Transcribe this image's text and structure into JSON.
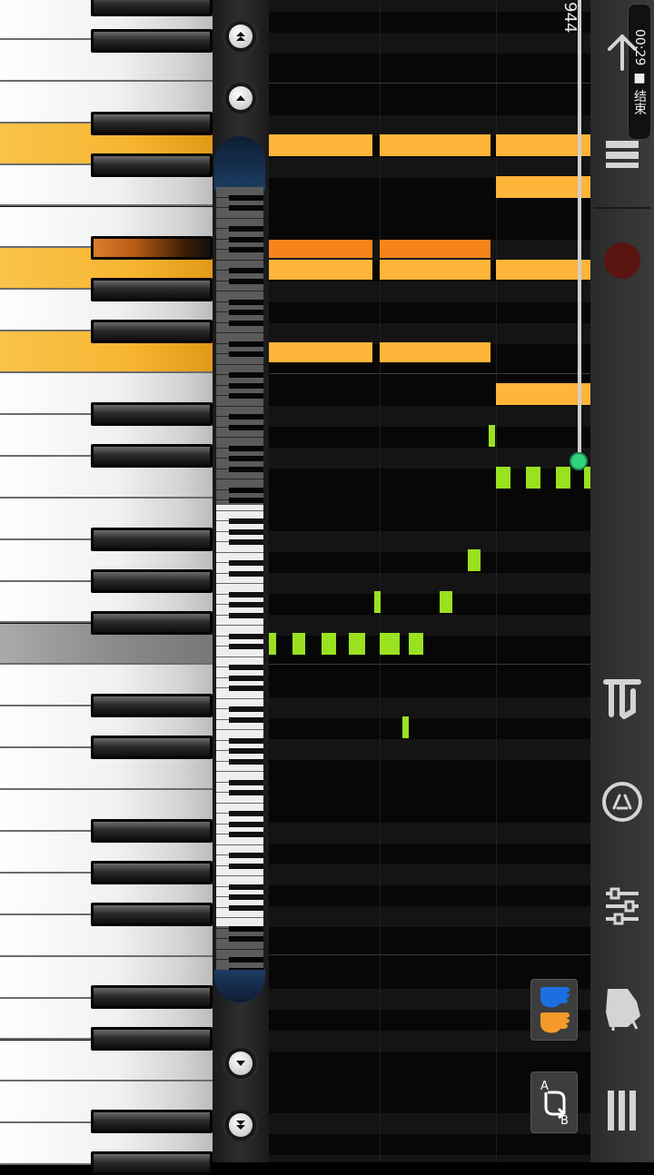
{
  "status": {
    "clock": "00:29",
    "end_label": "■ 结束"
  },
  "playback": {
    "position_readout": "944"
  },
  "navigation": {
    "fast_up_icon": "double-chevron-up",
    "up_icon": "chevron-up",
    "down_icon": "chevron-down",
    "fast_down_icon": "double-chevron-down"
  },
  "side_panel": {
    "buttons": [
      "back",
      "pause",
      "record",
      "playback-mode",
      "metronome",
      "mixer",
      "instrument",
      "menu"
    ]
  },
  "bottom_tools": {
    "ab_label_a": "A",
    "ab_label_b": "B"
  },
  "colors": {
    "right_hand_notes": "#ffb43a",
    "pressed_note": "#f7841a",
    "left_hand_notes": "#9ae11f",
    "playhead_dot": "#2fd57a",
    "record": "#5a1410",
    "left_hand_icon": "#1b6fe0",
    "right_hand_icon": "#f39a2a"
  }
}
